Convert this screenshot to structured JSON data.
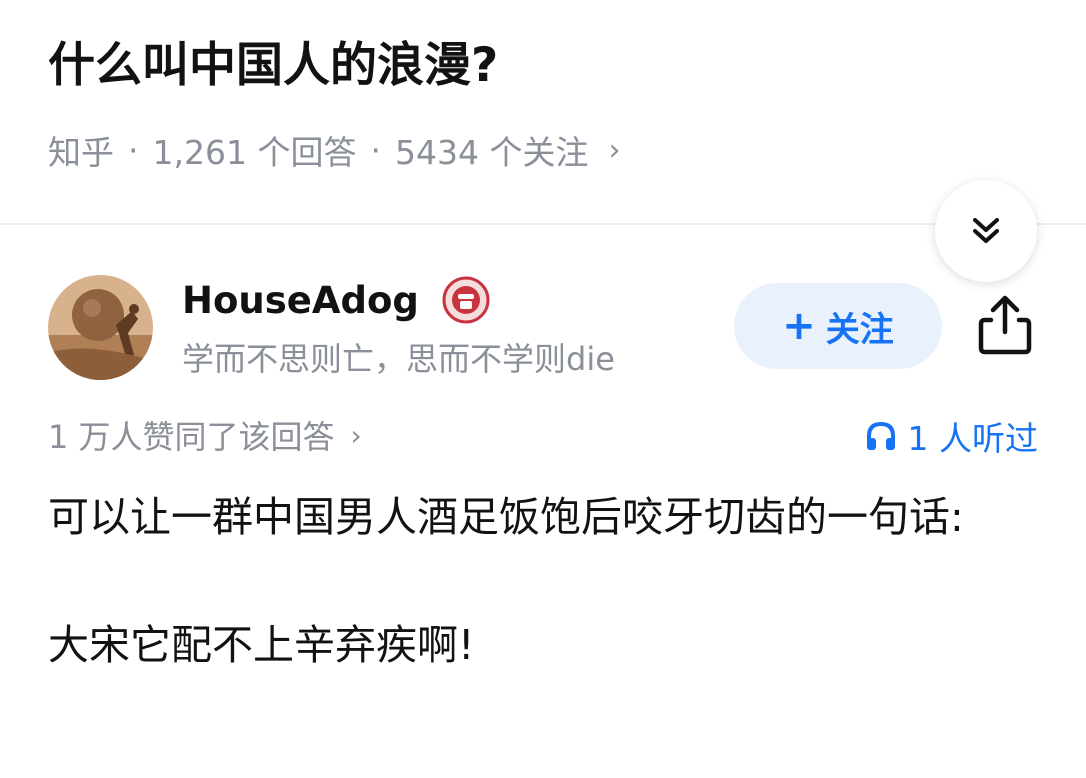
{
  "question": {
    "title": "什么叫中国人的浪漫?",
    "source": "知乎",
    "separator": "·",
    "answers": "1,261 个回答",
    "followers": "5434 个关注",
    "chevron": "›"
  },
  "author": {
    "name": "HouseAdog",
    "bio": "学而不思则亡，思而不学则die",
    "avatar_icon": "sisyphus-avatar",
    "badge_icon": "badge-icon"
  },
  "actions": {
    "follow_plus": "+",
    "follow_label": "关注",
    "share_icon": "share-icon",
    "collapse_icon": "double-chevron-down-icon"
  },
  "stats": {
    "upvotes": "1 万人赞同了该回答",
    "chevron": "›",
    "listened": "1 人听过",
    "listened_icon": "headphones-icon"
  },
  "answer": {
    "paragraph1": "可以让一群中国男人酒足饭饱后咬牙切齿的一句话:",
    "paragraph2": "大宋它配不上辛弃疾啊!"
  },
  "colors": {
    "accent": "#1772f6",
    "follow_bg": "#e8f1fc",
    "meta_gray": "#8a8f99",
    "badge_red": "#c7343f"
  }
}
